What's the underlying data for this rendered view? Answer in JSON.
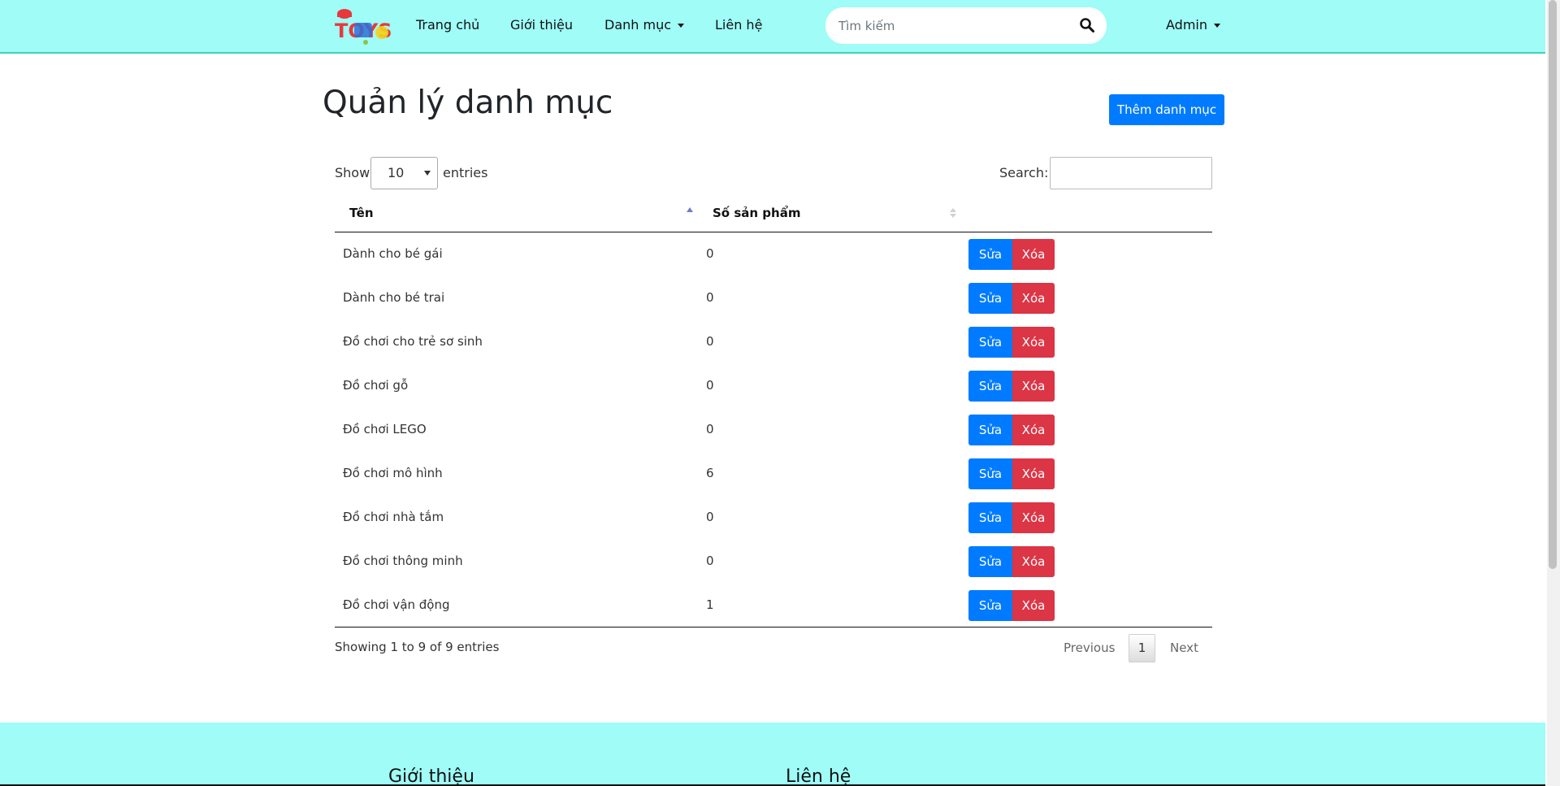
{
  "nav": {
    "logo_text": "TOYS",
    "links": [
      "Trang chủ",
      "Giới thiệu",
      "Danh mục",
      "Liên hệ"
    ],
    "search_placeholder": "Tìm kiếm",
    "admin_label": "Admin"
  },
  "page": {
    "title": "Quản lý danh mục",
    "add_button": "Thêm danh mục"
  },
  "table_controls": {
    "show_label": "Show",
    "entries_value": "10",
    "entries_label": "entries",
    "search_label": "Search:"
  },
  "table": {
    "columns": [
      "Tên",
      "Số sản phẩm"
    ],
    "edit_label": "Sửa",
    "delete_label": "Xóa",
    "rows": [
      {
        "name": "Dành cho bé gái",
        "count": "0"
      },
      {
        "name": "Dành cho bé trai",
        "count": "0"
      },
      {
        "name": "Đồ chơi cho trẻ sơ sinh",
        "count": "0"
      },
      {
        "name": "Đồ chơi gỗ",
        "count": "0"
      },
      {
        "name": "Đồ chơi LEGO",
        "count": "0"
      },
      {
        "name": "Đồ chơi mô hình",
        "count": "6"
      },
      {
        "name": "Đồ chơi nhà tắm",
        "count": "0"
      },
      {
        "name": "Đồ chơi thông minh",
        "count": "0"
      },
      {
        "name": "Đồ chơi vận động",
        "count": "1"
      }
    ]
  },
  "pagination": {
    "info": "Showing 1 to 9 of 9 entries",
    "previous": "Previous",
    "page": "1",
    "next": "Next"
  },
  "footer": {
    "titles": [
      "Giới thiệu",
      "Liên hệ"
    ]
  },
  "colors": {
    "nav_bg": "#9ffcf7",
    "primary": "#007bff",
    "danger": "#dc3545"
  }
}
